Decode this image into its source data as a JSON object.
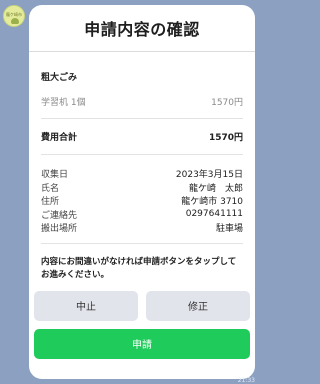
{
  "header": {
    "title": "申請内容の確認"
  },
  "item_section": {
    "title": "粗大ごみ",
    "items": [
      {
        "name": "学習机 1個",
        "price": "1570円"
      }
    ]
  },
  "total": {
    "label": "費用合計",
    "value": "1570円"
  },
  "details": [
    {
      "label": "収集日",
      "value": "2023年3月15日"
    },
    {
      "label": "氏名",
      "value": "龍ケ崎　太郎"
    },
    {
      "label": "住所",
      "value": "龍ケ崎市 3710"
    },
    {
      "label": "ご連絡先",
      "value": "0297641111"
    },
    {
      "label": "搬出場所",
      "value": "駐車場"
    }
  ],
  "notice": "内容にお間違いがなければ申請ボタンをタップしてお進みください。",
  "buttons": {
    "stop": "中止",
    "edit": "修正",
    "apply": "申請"
  },
  "avatar": {
    "text": "龍ケ崎市"
  },
  "time": "21:33",
  "colors": {
    "background": "#8ca0c2",
    "apply_button": "#1fcb5b",
    "secondary_button": "#e2e4ec"
  }
}
